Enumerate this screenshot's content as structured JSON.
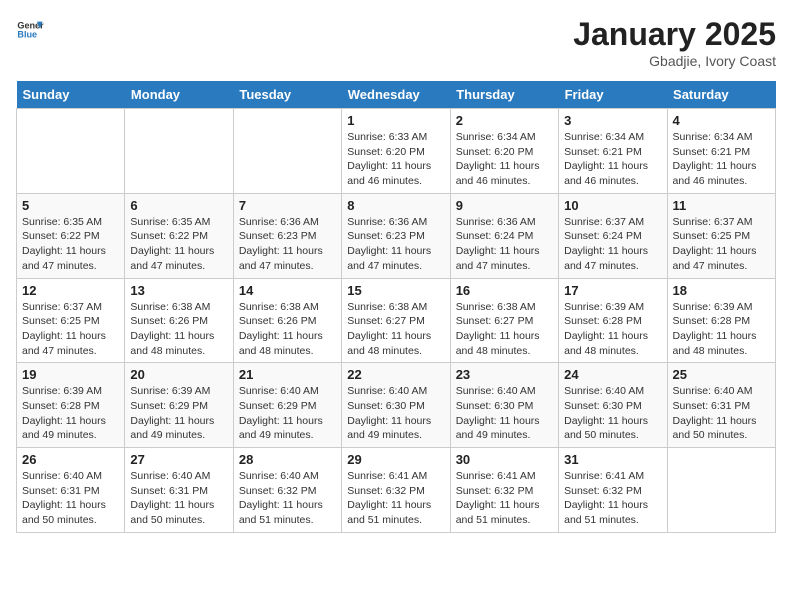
{
  "header": {
    "logo_line1": "General",
    "logo_line2": "Blue",
    "month_title": "January 2025",
    "location": "Gbadjie, Ivory Coast"
  },
  "weekdays": [
    "Sunday",
    "Monday",
    "Tuesday",
    "Wednesday",
    "Thursday",
    "Friday",
    "Saturday"
  ],
  "weeks": [
    [
      {
        "day": "",
        "sunrise": "",
        "sunset": "",
        "daylight": ""
      },
      {
        "day": "",
        "sunrise": "",
        "sunset": "",
        "daylight": ""
      },
      {
        "day": "",
        "sunrise": "",
        "sunset": "",
        "daylight": ""
      },
      {
        "day": "1",
        "sunrise": "6:33 AM",
        "sunset": "6:20 PM",
        "daylight": "11 hours and 46 minutes."
      },
      {
        "day": "2",
        "sunrise": "6:34 AM",
        "sunset": "6:20 PM",
        "daylight": "11 hours and 46 minutes."
      },
      {
        "day": "3",
        "sunrise": "6:34 AM",
        "sunset": "6:21 PM",
        "daylight": "11 hours and 46 minutes."
      },
      {
        "day": "4",
        "sunrise": "6:34 AM",
        "sunset": "6:21 PM",
        "daylight": "11 hours and 46 minutes."
      }
    ],
    [
      {
        "day": "5",
        "sunrise": "6:35 AM",
        "sunset": "6:22 PM",
        "daylight": "11 hours and 47 minutes."
      },
      {
        "day": "6",
        "sunrise": "6:35 AM",
        "sunset": "6:22 PM",
        "daylight": "11 hours and 47 minutes."
      },
      {
        "day": "7",
        "sunrise": "6:36 AM",
        "sunset": "6:23 PM",
        "daylight": "11 hours and 47 minutes."
      },
      {
        "day": "8",
        "sunrise": "6:36 AM",
        "sunset": "6:23 PM",
        "daylight": "11 hours and 47 minutes."
      },
      {
        "day": "9",
        "sunrise": "6:36 AM",
        "sunset": "6:24 PM",
        "daylight": "11 hours and 47 minutes."
      },
      {
        "day": "10",
        "sunrise": "6:37 AM",
        "sunset": "6:24 PM",
        "daylight": "11 hours and 47 minutes."
      },
      {
        "day": "11",
        "sunrise": "6:37 AM",
        "sunset": "6:25 PM",
        "daylight": "11 hours and 47 minutes."
      }
    ],
    [
      {
        "day": "12",
        "sunrise": "6:37 AM",
        "sunset": "6:25 PM",
        "daylight": "11 hours and 47 minutes."
      },
      {
        "day": "13",
        "sunrise": "6:38 AM",
        "sunset": "6:26 PM",
        "daylight": "11 hours and 48 minutes."
      },
      {
        "day": "14",
        "sunrise": "6:38 AM",
        "sunset": "6:26 PM",
        "daylight": "11 hours and 48 minutes."
      },
      {
        "day": "15",
        "sunrise": "6:38 AM",
        "sunset": "6:27 PM",
        "daylight": "11 hours and 48 minutes."
      },
      {
        "day": "16",
        "sunrise": "6:38 AM",
        "sunset": "6:27 PM",
        "daylight": "11 hours and 48 minutes."
      },
      {
        "day": "17",
        "sunrise": "6:39 AM",
        "sunset": "6:28 PM",
        "daylight": "11 hours and 48 minutes."
      },
      {
        "day": "18",
        "sunrise": "6:39 AM",
        "sunset": "6:28 PM",
        "daylight": "11 hours and 48 minutes."
      }
    ],
    [
      {
        "day": "19",
        "sunrise": "6:39 AM",
        "sunset": "6:28 PM",
        "daylight": "11 hours and 49 minutes."
      },
      {
        "day": "20",
        "sunrise": "6:39 AM",
        "sunset": "6:29 PM",
        "daylight": "11 hours and 49 minutes."
      },
      {
        "day": "21",
        "sunrise": "6:40 AM",
        "sunset": "6:29 PM",
        "daylight": "11 hours and 49 minutes."
      },
      {
        "day": "22",
        "sunrise": "6:40 AM",
        "sunset": "6:30 PM",
        "daylight": "11 hours and 49 minutes."
      },
      {
        "day": "23",
        "sunrise": "6:40 AM",
        "sunset": "6:30 PM",
        "daylight": "11 hours and 49 minutes."
      },
      {
        "day": "24",
        "sunrise": "6:40 AM",
        "sunset": "6:30 PM",
        "daylight": "11 hours and 50 minutes."
      },
      {
        "day": "25",
        "sunrise": "6:40 AM",
        "sunset": "6:31 PM",
        "daylight": "11 hours and 50 minutes."
      }
    ],
    [
      {
        "day": "26",
        "sunrise": "6:40 AM",
        "sunset": "6:31 PM",
        "daylight": "11 hours and 50 minutes."
      },
      {
        "day": "27",
        "sunrise": "6:40 AM",
        "sunset": "6:31 PM",
        "daylight": "11 hours and 50 minutes."
      },
      {
        "day": "28",
        "sunrise": "6:40 AM",
        "sunset": "6:32 PM",
        "daylight": "11 hours and 51 minutes."
      },
      {
        "day": "29",
        "sunrise": "6:41 AM",
        "sunset": "6:32 PM",
        "daylight": "11 hours and 51 minutes."
      },
      {
        "day": "30",
        "sunrise": "6:41 AM",
        "sunset": "6:32 PM",
        "daylight": "11 hours and 51 minutes."
      },
      {
        "day": "31",
        "sunrise": "6:41 AM",
        "sunset": "6:32 PM",
        "daylight": "11 hours and 51 minutes."
      },
      {
        "day": "",
        "sunrise": "",
        "sunset": "",
        "daylight": ""
      }
    ]
  ],
  "labels": {
    "sunrise_prefix": "Sunrise: ",
    "sunset_prefix": "Sunset: ",
    "daylight_prefix": "Daylight: "
  }
}
